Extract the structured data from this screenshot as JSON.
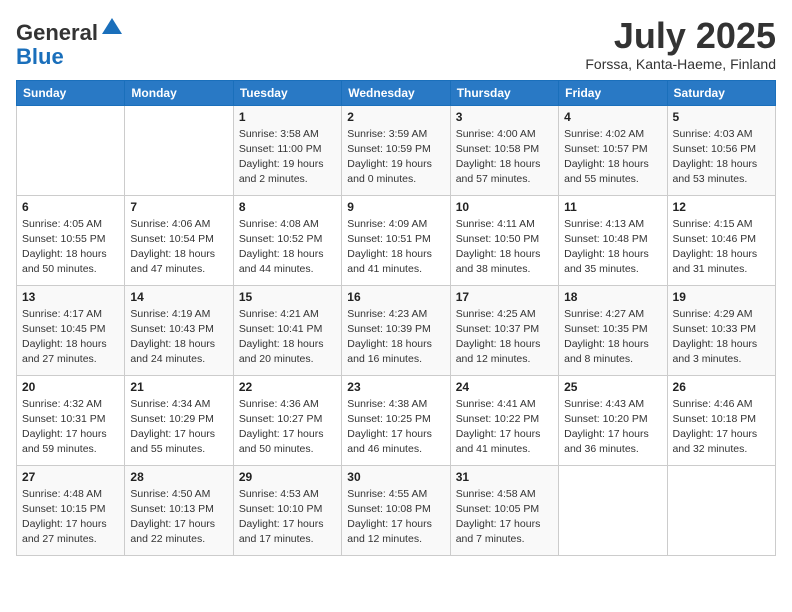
{
  "logo": {
    "general": "General",
    "blue": "Blue"
  },
  "title": "July 2025",
  "subtitle": "Forssa, Kanta-Haeme, Finland",
  "days_header": [
    "Sunday",
    "Monday",
    "Tuesday",
    "Wednesday",
    "Thursday",
    "Friday",
    "Saturday"
  ],
  "weeks": [
    [
      null,
      null,
      {
        "day": "1",
        "sunrise": "Sunrise: 3:58 AM",
        "sunset": "Sunset: 11:00 PM",
        "daylight": "Daylight: 19 hours and 2 minutes."
      },
      {
        "day": "2",
        "sunrise": "Sunrise: 3:59 AM",
        "sunset": "Sunset: 10:59 PM",
        "daylight": "Daylight: 19 hours and 0 minutes."
      },
      {
        "day": "3",
        "sunrise": "Sunrise: 4:00 AM",
        "sunset": "Sunset: 10:58 PM",
        "daylight": "Daylight: 18 hours and 57 minutes."
      },
      {
        "day": "4",
        "sunrise": "Sunrise: 4:02 AM",
        "sunset": "Sunset: 10:57 PM",
        "daylight": "Daylight: 18 hours and 55 minutes."
      },
      {
        "day": "5",
        "sunrise": "Sunrise: 4:03 AM",
        "sunset": "Sunset: 10:56 PM",
        "daylight": "Daylight: 18 hours and 53 minutes."
      }
    ],
    [
      {
        "day": "6",
        "sunrise": "Sunrise: 4:05 AM",
        "sunset": "Sunset: 10:55 PM",
        "daylight": "Daylight: 18 hours and 50 minutes."
      },
      {
        "day": "7",
        "sunrise": "Sunrise: 4:06 AM",
        "sunset": "Sunset: 10:54 PM",
        "daylight": "Daylight: 18 hours and 47 minutes."
      },
      {
        "day": "8",
        "sunrise": "Sunrise: 4:08 AM",
        "sunset": "Sunset: 10:52 PM",
        "daylight": "Daylight: 18 hours and 44 minutes."
      },
      {
        "day": "9",
        "sunrise": "Sunrise: 4:09 AM",
        "sunset": "Sunset: 10:51 PM",
        "daylight": "Daylight: 18 hours and 41 minutes."
      },
      {
        "day": "10",
        "sunrise": "Sunrise: 4:11 AM",
        "sunset": "Sunset: 10:50 PM",
        "daylight": "Daylight: 18 hours and 38 minutes."
      },
      {
        "day": "11",
        "sunrise": "Sunrise: 4:13 AM",
        "sunset": "Sunset: 10:48 PM",
        "daylight": "Daylight: 18 hours and 35 minutes."
      },
      {
        "day": "12",
        "sunrise": "Sunrise: 4:15 AM",
        "sunset": "Sunset: 10:46 PM",
        "daylight": "Daylight: 18 hours and 31 minutes."
      }
    ],
    [
      {
        "day": "13",
        "sunrise": "Sunrise: 4:17 AM",
        "sunset": "Sunset: 10:45 PM",
        "daylight": "Daylight: 18 hours and 27 minutes."
      },
      {
        "day": "14",
        "sunrise": "Sunrise: 4:19 AM",
        "sunset": "Sunset: 10:43 PM",
        "daylight": "Daylight: 18 hours and 24 minutes."
      },
      {
        "day": "15",
        "sunrise": "Sunrise: 4:21 AM",
        "sunset": "Sunset: 10:41 PM",
        "daylight": "Daylight: 18 hours and 20 minutes."
      },
      {
        "day": "16",
        "sunrise": "Sunrise: 4:23 AM",
        "sunset": "Sunset: 10:39 PM",
        "daylight": "Daylight: 18 hours and 16 minutes."
      },
      {
        "day": "17",
        "sunrise": "Sunrise: 4:25 AM",
        "sunset": "Sunset: 10:37 PM",
        "daylight": "Daylight: 18 hours and 12 minutes."
      },
      {
        "day": "18",
        "sunrise": "Sunrise: 4:27 AM",
        "sunset": "Sunset: 10:35 PM",
        "daylight": "Daylight: 18 hours and 8 minutes."
      },
      {
        "day": "19",
        "sunrise": "Sunrise: 4:29 AM",
        "sunset": "Sunset: 10:33 PM",
        "daylight": "Daylight: 18 hours and 3 minutes."
      }
    ],
    [
      {
        "day": "20",
        "sunrise": "Sunrise: 4:32 AM",
        "sunset": "Sunset: 10:31 PM",
        "daylight": "Daylight: 17 hours and 59 minutes."
      },
      {
        "day": "21",
        "sunrise": "Sunrise: 4:34 AM",
        "sunset": "Sunset: 10:29 PM",
        "daylight": "Daylight: 17 hours and 55 minutes."
      },
      {
        "day": "22",
        "sunrise": "Sunrise: 4:36 AM",
        "sunset": "Sunset: 10:27 PM",
        "daylight": "Daylight: 17 hours and 50 minutes."
      },
      {
        "day": "23",
        "sunrise": "Sunrise: 4:38 AM",
        "sunset": "Sunset: 10:25 PM",
        "daylight": "Daylight: 17 hours and 46 minutes."
      },
      {
        "day": "24",
        "sunrise": "Sunrise: 4:41 AM",
        "sunset": "Sunset: 10:22 PM",
        "daylight": "Daylight: 17 hours and 41 minutes."
      },
      {
        "day": "25",
        "sunrise": "Sunrise: 4:43 AM",
        "sunset": "Sunset: 10:20 PM",
        "daylight": "Daylight: 17 hours and 36 minutes."
      },
      {
        "day": "26",
        "sunrise": "Sunrise: 4:46 AM",
        "sunset": "Sunset: 10:18 PM",
        "daylight": "Daylight: 17 hours and 32 minutes."
      }
    ],
    [
      {
        "day": "27",
        "sunrise": "Sunrise: 4:48 AM",
        "sunset": "Sunset: 10:15 PM",
        "daylight": "Daylight: 17 hours and 27 minutes."
      },
      {
        "day": "28",
        "sunrise": "Sunrise: 4:50 AM",
        "sunset": "Sunset: 10:13 PM",
        "daylight": "Daylight: 17 hours and 22 minutes."
      },
      {
        "day": "29",
        "sunrise": "Sunrise: 4:53 AM",
        "sunset": "Sunset: 10:10 PM",
        "daylight": "Daylight: 17 hours and 17 minutes."
      },
      {
        "day": "30",
        "sunrise": "Sunrise: 4:55 AM",
        "sunset": "Sunset: 10:08 PM",
        "daylight": "Daylight: 17 hours and 12 minutes."
      },
      {
        "day": "31",
        "sunrise": "Sunrise: 4:58 AM",
        "sunset": "Sunset: 10:05 PM",
        "daylight": "Daylight: 17 hours and 7 minutes."
      },
      null,
      null
    ]
  ]
}
